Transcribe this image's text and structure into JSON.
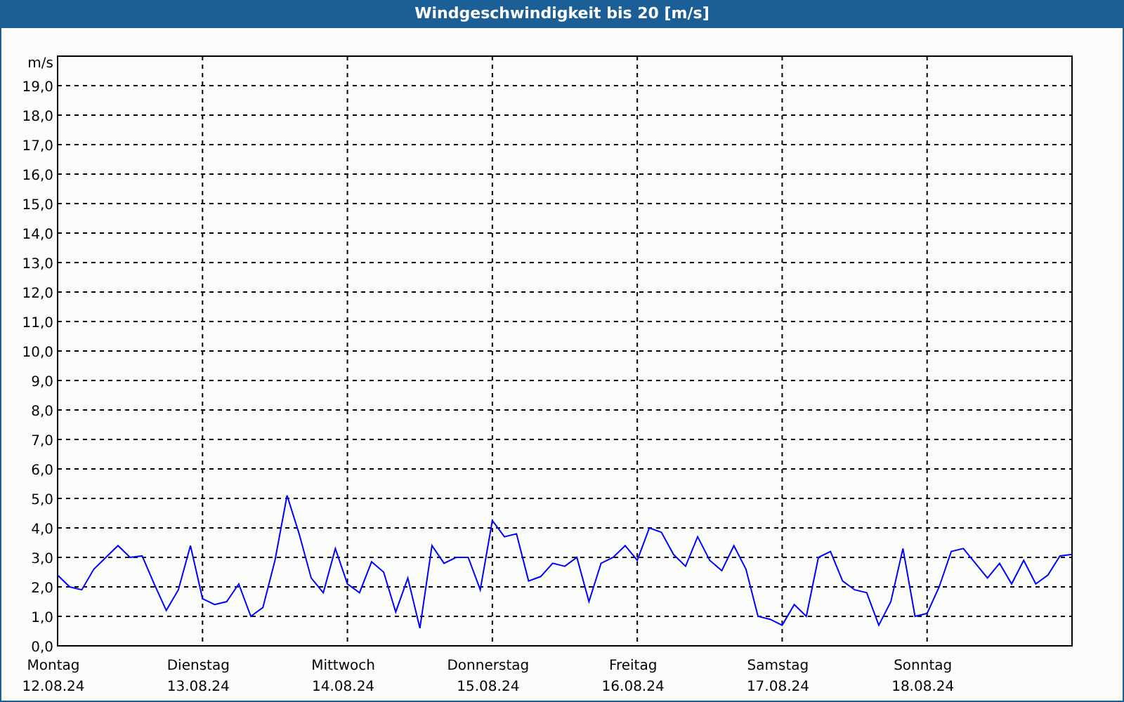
{
  "weekday_labels": [
    "Montag",
    "Dienstag",
    "Mittwoch",
    "Donnerstag",
    "Freitag",
    "Samstag",
    "Sonntag"
  ],
  "chart_data": {
    "type": "line",
    "title": "Windgeschwindigkeit bis 20 [m/s]",
    "ylabel": "m/s",
    "ylim": [
      0,
      20
    ],
    "grid": true,
    "yticks": [
      {
        "value": 0,
        "label": "0,0"
      },
      {
        "value": 1,
        "label": "1,0"
      },
      {
        "value": 2,
        "label": "2,0"
      },
      {
        "value": 3,
        "label": "3,0"
      },
      {
        "value": 4,
        "label": "4,0"
      },
      {
        "value": 5,
        "label": "5,0"
      },
      {
        "value": 6,
        "label": "6,0"
      },
      {
        "value": 7,
        "label": "7,0"
      },
      {
        "value": 8,
        "label": "8,0"
      },
      {
        "value": 9,
        "label": "9,0"
      },
      {
        "value": 10,
        "label": "10,0"
      },
      {
        "value": 11,
        "label": "11,0"
      },
      {
        "value": 12,
        "label": "12,0"
      },
      {
        "value": 13,
        "label": "13,0"
      },
      {
        "value": 14,
        "label": "14,0"
      },
      {
        "value": 15,
        "label": "15,0"
      },
      {
        "value": 16,
        "label": "16,0"
      },
      {
        "value": 17,
        "label": "17,0"
      },
      {
        "value": 18,
        "label": "18,0"
      },
      {
        "value": 19,
        "label": "19,0"
      }
    ],
    "categories": [
      "12.08.24",
      null,
      null,
      null,
      null,
      null,
      null,
      null,
      null,
      null,
      null,
      null,
      "13.08.24",
      null,
      null,
      null,
      null,
      null,
      null,
      null,
      null,
      null,
      null,
      null,
      "14.08.24",
      null,
      null,
      null,
      null,
      null,
      null,
      null,
      null,
      null,
      null,
      null,
      "15.08.24",
      null,
      null,
      null,
      null,
      null,
      null,
      null,
      null,
      null,
      null,
      null,
      "16.08.24",
      null,
      null,
      null,
      null,
      null,
      null,
      null,
      null,
      null,
      null,
      null,
      "17.08.24",
      null,
      null,
      null,
      null,
      null,
      null,
      null,
      null,
      null,
      null,
      null,
      "18.08.24",
      null,
      null,
      null,
      null,
      null,
      null,
      null,
      null,
      null,
      null,
      null,
      null
    ],
    "series": [
      {
        "color": "#0000ff",
        "values": [
          2.4,
          2.0,
          1.9,
          2.6,
          3.0,
          3.4,
          3.0,
          3.05,
          2.1,
          1.2,
          1.9,
          3.4,
          1.6,
          1.4,
          1.5,
          2.1,
          1.0,
          1.3,
          2.9,
          5.1,
          3.8,
          2.3,
          1.8,
          3.3,
          2.1,
          1.8,
          2.85,
          2.5,
          1.15,
          2.3,
          0.6,
          3.4,
          2.8,
          3.0,
          3.0,
          1.9,
          4.25,
          3.7,
          3.8,
          2.2,
          2.35,
          2.8,
          2.7,
          3.0,
          1.5,
          2.8,
          3.0,
          3.4,
          2.9,
          4.0,
          3.85,
          3.1,
          2.7,
          3.7,
          2.9,
          2.55,
          3.4,
          2.6,
          1.0,
          0.9,
          0.7,
          1.4,
          1.0,
          3.0,
          3.2,
          2.2,
          1.9,
          1.8,
          0.7,
          1.5,
          3.3,
          1.0,
          1.1,
          2.0,
          3.2,
          3.3,
          2.8,
          2.3,
          2.8,
          2.1,
          2.9,
          2.1,
          2.4,
          3.05,
          3.1
        ]
      }
    ]
  }
}
